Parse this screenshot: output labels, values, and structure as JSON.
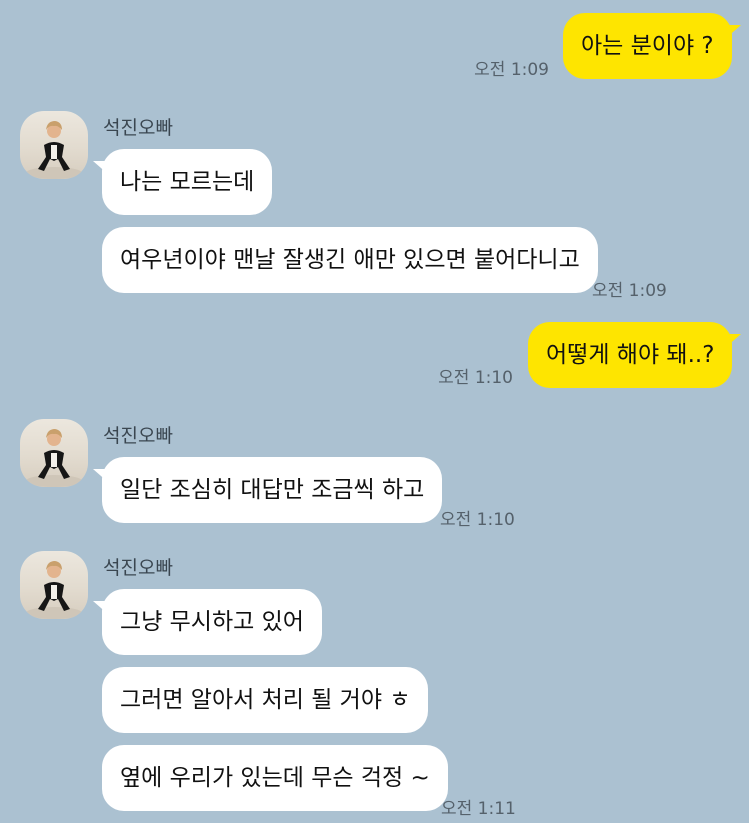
{
  "colors": {
    "background": "#abc1d1",
    "incoming_bubble": "#ffffff",
    "outgoing_bubble": "#fee500"
  },
  "messages": {
    "m1": {
      "text": "아는 분이야 ?",
      "time": "오전 1:09"
    },
    "g1": {
      "sender": "석진오빠",
      "b1": "나는 모르는데",
      "b2": "여우년이야 맨날 잘생긴 애만 있으면 붙어다니고",
      "time": "오전 1:09"
    },
    "m2": {
      "text": "어떻게 해야 돼..?",
      "time": "오전 1:10"
    },
    "g2": {
      "sender": "석진오빠",
      "b1": "일단 조심히 대답만 조금씩 하고",
      "time": "오전 1:10"
    },
    "g3": {
      "sender": "석진오빠",
      "b1": "그냥 무시하고 있어",
      "b2": "그러면 알아서 처리 될 거야 ㅎ",
      "b3": "옆에 우리가 있는데 무슨 걱정 ~",
      "time": "오전 1:11"
    }
  },
  "avatar_icon": "profile-photo"
}
